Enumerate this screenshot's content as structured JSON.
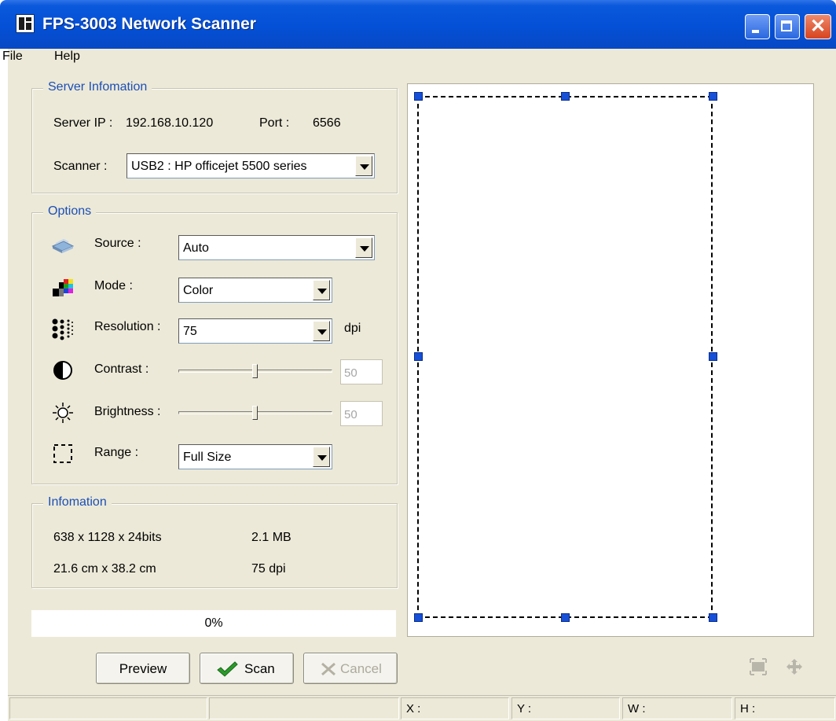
{
  "window": {
    "title": "FPS-3003 Network Scanner"
  },
  "menu": {
    "items": [
      "File",
      "Help"
    ]
  },
  "server": {
    "legend": "Server Infomation",
    "ip_label": "Server IP :",
    "ip_value": "192.168.10.120",
    "port_label": "Port :",
    "port_value": "6566",
    "scanner_label": "Scanner :",
    "scanner_value": "USB2 : HP officejet 5500 series"
  },
  "options": {
    "legend": "Options",
    "source_label": "Source :",
    "source_value": "Auto",
    "mode_label": "Mode :",
    "mode_value": "Color",
    "resolution_label": "Resolution :",
    "resolution_value": "75",
    "resolution_unit": "dpi",
    "contrast_label": "Contrast :",
    "contrast_value": "50",
    "brightness_label": "Brightness :",
    "brightness_value": "50",
    "range_label": "Range :",
    "range_value": "Full Size"
  },
  "info": {
    "legend": "Infomation",
    "pixels": "638 x 1128 x 24bits",
    "size": "2.1 MB",
    "dimensions": "21.6 cm x 38.2 cm",
    "dpi": "75 dpi"
  },
  "progress": {
    "text": "0%",
    "fraction": 0
  },
  "buttons": {
    "preview": "Preview",
    "scan": "Scan",
    "cancel": "Cancel"
  },
  "status": {
    "x": "X :",
    "y": "Y :",
    "w": "W :",
    "h": "H :"
  },
  "icons": {
    "source": "scanner-icon",
    "mode": "color-mode-icon",
    "resolution": "dots-icon",
    "contrast": "contrast-icon",
    "brightness": "sun-icon",
    "range": "range-icon",
    "scan": "checkmark-icon",
    "cancel": "x-icon",
    "fit": "fit-icon",
    "move": "move-icon"
  }
}
